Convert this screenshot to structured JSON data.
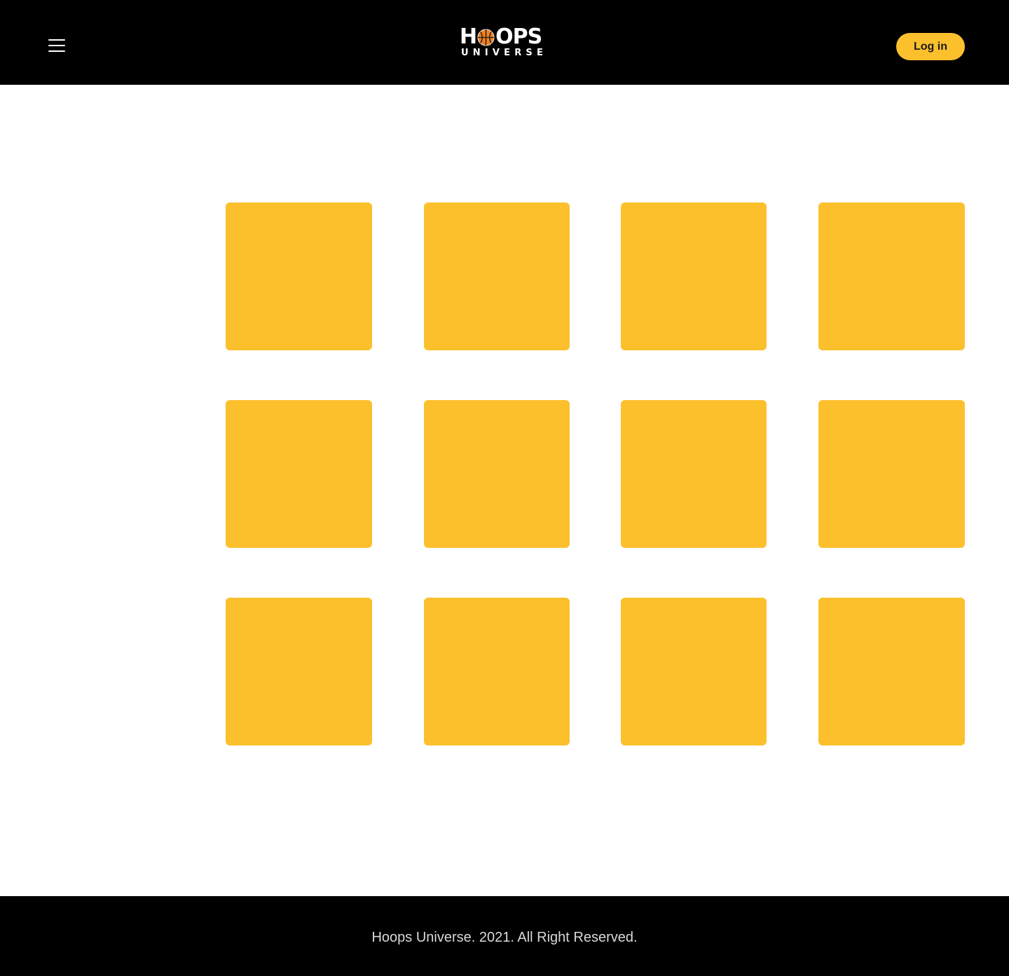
{
  "header": {
    "menu_icon": "hamburger-menu-icon",
    "logo": {
      "line1_before": "H",
      "line1_after": "OPS",
      "ball_icon": "basketball-icon",
      "line2": "UNIVERSE",
      "ball_color": "#f07f1e"
    },
    "login_label": "Log in"
  },
  "colors": {
    "header_bg": "#000000",
    "accent": "#fcc02d",
    "footer_text": "#d9d9d9"
  },
  "grid": {
    "tiles": [
      "",
      "",
      "",
      "",
      "",
      "",
      "",
      "",
      "",
      "",
      "",
      ""
    ]
  },
  "footer": {
    "text": "Hoops Universe. 2021. All Right Reserved."
  }
}
